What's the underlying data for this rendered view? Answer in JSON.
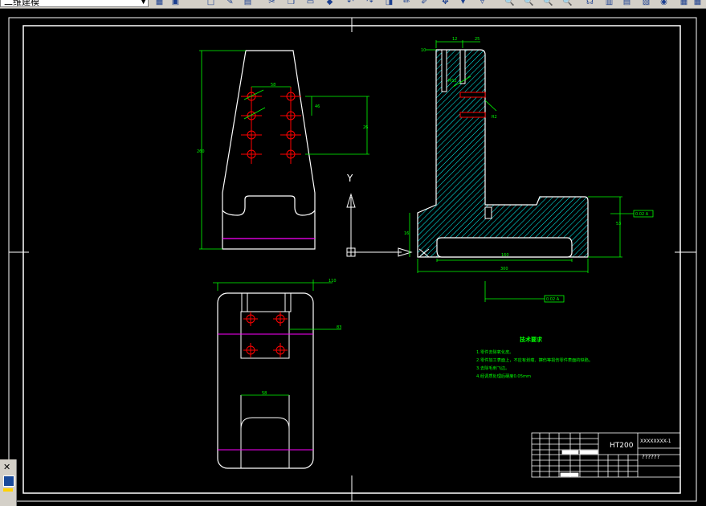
{
  "toolbar": {
    "workspace_value": "二维建模",
    "icons": [
      "layers-icon",
      "properties-icon",
      "save-icon",
      "pan-icon",
      "orbit-icon",
      "zoom-realtime-icon",
      "zoom-window-icon",
      "zoom-previous-icon",
      "zoom-extents-icon",
      "measure-icon",
      "grid-icon"
    ]
  },
  "colors": {
    "background": "#000000",
    "white_line": "#ffffff",
    "dimension": "#00ff00",
    "hatch": "#00ffff",
    "red": "#ff0000",
    "magenta": "#ff00ff"
  },
  "drawing": {
    "dims_front": {
      "width": "58",
      "pitch": "46",
      "height_right": "26",
      "height_total": "260"
    },
    "dims_side": {
      "a": "12",
      "b": "25",
      "c": "10",
      "d": "R2",
      "e": "M12",
      "f": "160",
      "g": "300",
      "h": "53",
      "i": "16"
    },
    "dims_top": {
      "total": "110",
      "height": "83",
      "slot": "58"
    },
    "tolerance_1": "0.02 A",
    "tolerance_2": "0.02 A",
    "ucs_y": "Y",
    "tech_title": "技术要求",
    "tech_lines": [
      "1.零件去除氧化皮。",
      "2.零件加工表面上，不应有划痕、擦伤等损伤零件表面的缺陷。",
      "3.去除毛刺飞边。",
      "4.经调质处理后硬度0.05mm"
    ],
    "title_block": {
      "material": "HT200",
      "drawing_no": "XXXXXXXX-1",
      "name": "??????"
    }
  }
}
